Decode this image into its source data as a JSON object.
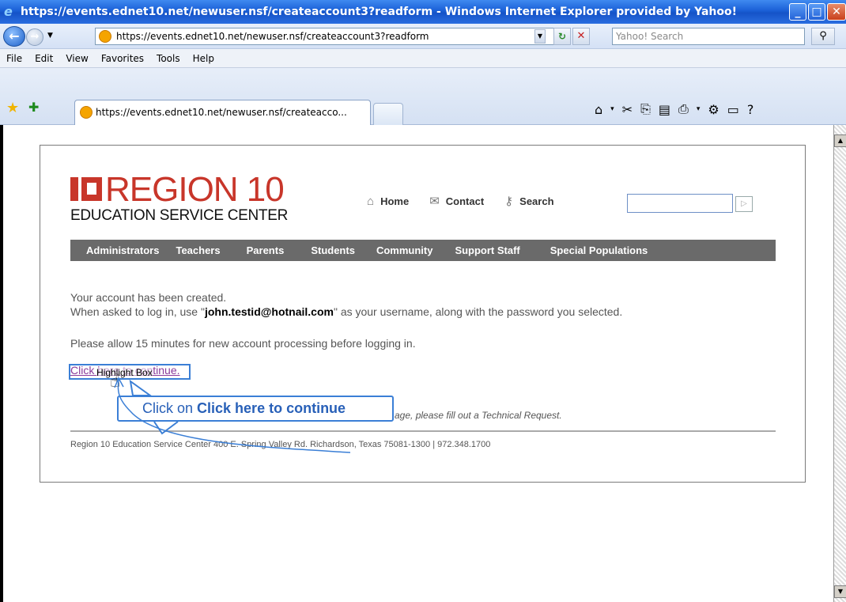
{
  "window": {
    "title": "https://events.ednet10.net/newuser.nsf/createaccount3?readform - Windows Internet Explorer provided by Yahoo!"
  },
  "addressbar": {
    "url": "https://events.ednet10.net/newuser.nsf/createaccount3?readform",
    "search_placeholder": "Yahoo! Search"
  },
  "menubar": {
    "items": [
      "File",
      "Edit",
      "View",
      "Favorites",
      "Tools",
      "Help"
    ]
  },
  "tabs": {
    "active_label": "https://events.ednet10.net/newuser.nsf/createacco..."
  },
  "site": {
    "logo_text": "REGION 10",
    "logo_subtext": "EDUCATION SERVICE CENTER",
    "toplinks": [
      "Home",
      "Contact",
      "Search"
    ],
    "nav": [
      "Administrators",
      "Teachers",
      "Parents",
      "Students",
      "Community",
      "Support Staff",
      "Special Populations"
    ]
  },
  "content": {
    "line1": "Your account has been created.",
    "line2_prefix": "When asked to log in, use  \"",
    "username": "john.testid@hotnail.com",
    "line2_suffix": "\"  as your username, along with the password you selected.",
    "line3": "Please allow 15 minutes for new account processing before logging in.",
    "continue_link": "Click here to continue.",
    "highlight_label": "Highlight Box",
    "callout_prefix": "Click on ",
    "callout_bold": "Click here to continue",
    "tech_request": "age, please fill out a Technical Request.",
    "footer": "Region 10 Education Service Center 400 E. Spring Valley Rd. Richardson, Texas 75081-1300 | 972.348.1700"
  },
  "colors": {
    "brand_red": "#c8362a",
    "nav_gray": "#6a6a6a",
    "callout_blue": "#3b7fd6"
  }
}
